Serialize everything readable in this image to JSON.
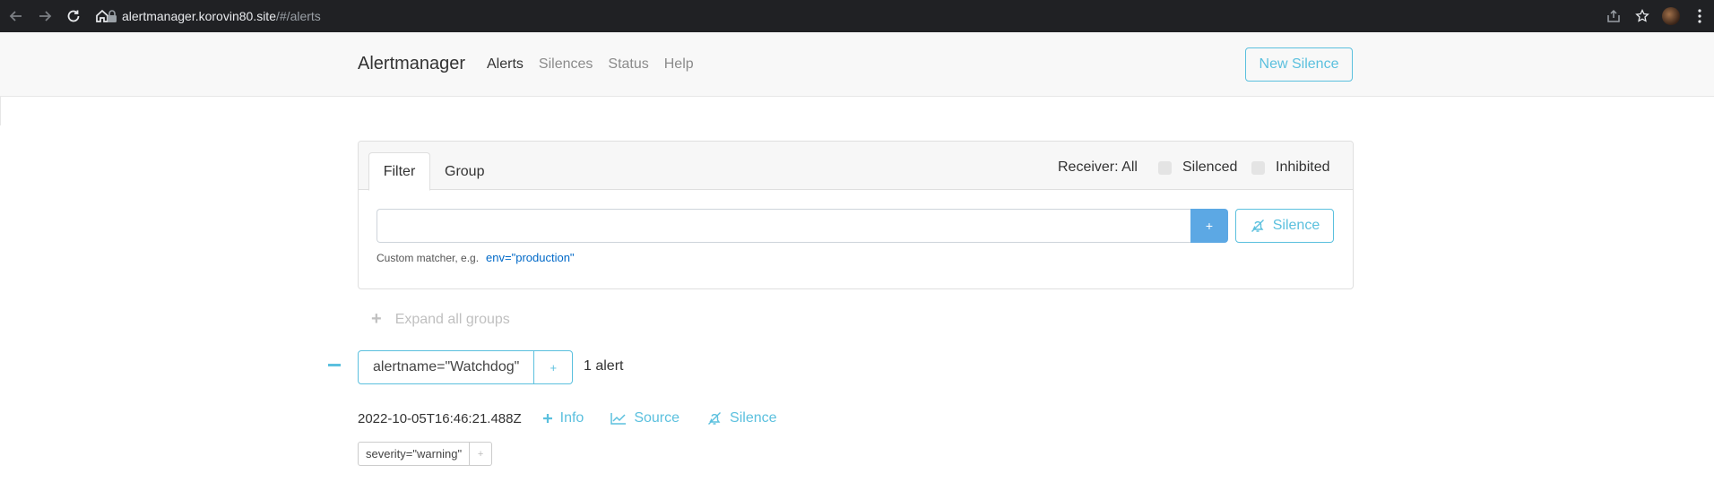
{
  "browser": {
    "url_host": "alertmanager.korovin80.site",
    "url_path": "/#/alerts"
  },
  "navbar": {
    "brand": "Alertmanager",
    "links": [
      "Alerts",
      "Silences",
      "Status",
      "Help"
    ],
    "active_link": "Alerts",
    "new_silence_label": "New Silence"
  },
  "filter_card": {
    "tabs": [
      "Filter",
      "Group"
    ],
    "receiver_label": "Receiver: All",
    "silenced_label": "Silenced",
    "inhibited_label": "Inhibited",
    "input_value": "",
    "add_label": "+",
    "silence_label": "Silence",
    "helper_text": "Custom matcher, e.g.",
    "helper_example": "env=\"production\""
  },
  "expand_all": "Expand all groups",
  "group": {
    "label": "alertname=\"Watchdog\"",
    "add_label": "+",
    "count": "1 alert"
  },
  "alert": {
    "timestamp": "2022-10-05T16:46:21.488Z",
    "info_label": "Info",
    "source_label": "Source",
    "silence_label": "Silence",
    "label": "severity=\"warning\"",
    "label_add": "+"
  },
  "colors": {
    "accent": "#5bc0de",
    "primary": "#5ca8e4",
    "chrome": "#202124"
  }
}
